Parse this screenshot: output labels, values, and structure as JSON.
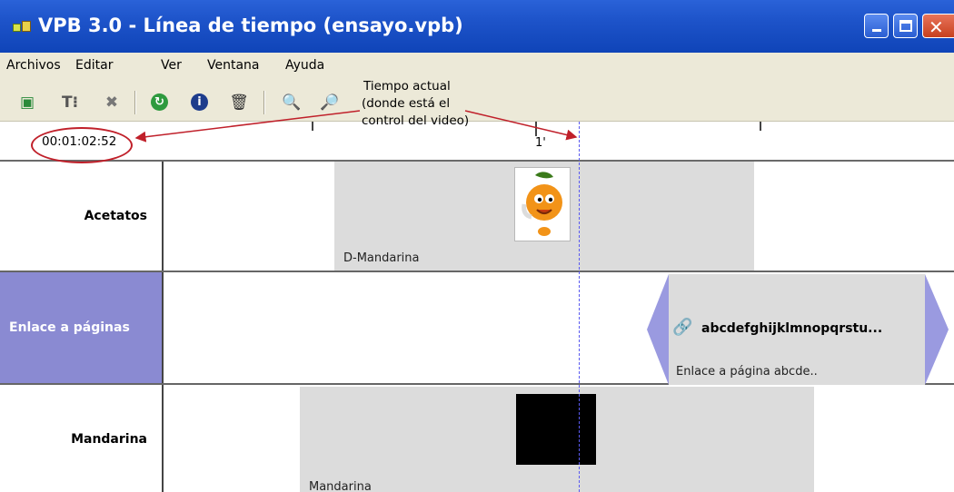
{
  "window": {
    "title": "VPB 3.0 - Línea de tiempo (ensayo.vpb)"
  },
  "menu": {
    "items": [
      "Archivos",
      "Editar",
      "Ver",
      "Ventana",
      "Ayuda"
    ]
  },
  "timeline": {
    "current_time": "00:01:02:52",
    "ruler_label": "1'"
  },
  "annotation": {
    "lines": [
      "Tiempo actual",
      "(donde está el",
      "control del video)"
    ]
  },
  "tracks": [
    {
      "label": "Acetatos",
      "clip_label": "D-Mandarina"
    },
    {
      "label": "Enlace a páginas",
      "clip_title": "abcdefghijklmnopqrstu...",
      "clip_label": "Enlace a página abcde.."
    },
    {
      "label": "Mandarina",
      "clip_label": "Mandarina"
    }
  ],
  "colors": {
    "titlebar": "#1d53c9",
    "selected_track": "#8a8ad2",
    "clip": "#dcdcdc",
    "annotation": "#c0202a"
  }
}
